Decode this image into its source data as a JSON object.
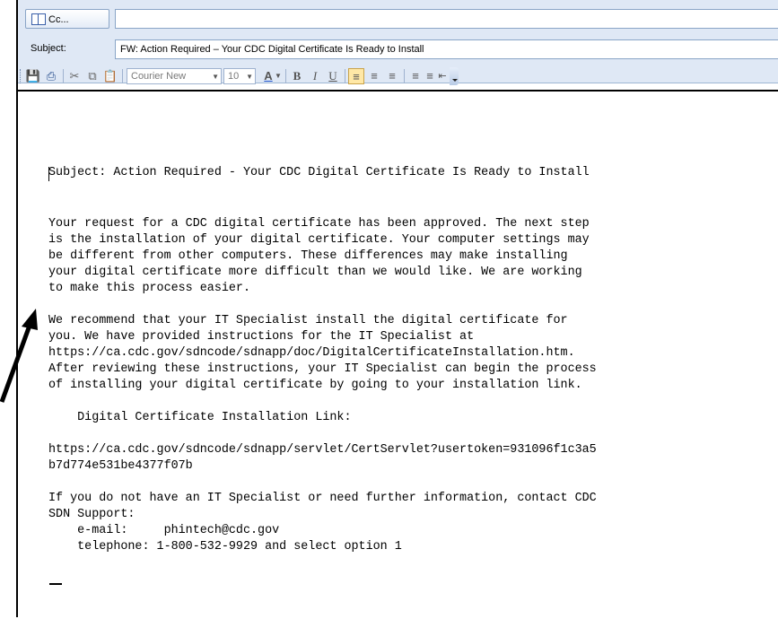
{
  "header": {
    "cc_label": "Cc...",
    "cc_value": "",
    "subject_label": "Subject:",
    "subject_value": "FW: Action Required – Your CDC Digital Certificate Is Ready to Install"
  },
  "toolbar": {
    "font_name": "Courier New",
    "font_size": "10",
    "icons": [
      "save-icon",
      "print-icon",
      "cut-icon",
      "copy-icon",
      "paste-icon",
      "font-color-icon",
      "bold-icon",
      "italic-icon",
      "underline-icon",
      "align-left-icon",
      "align-center-icon",
      "align-right-icon",
      "numbered-list-icon",
      "bulleted-list-icon",
      "decrease-indent-icon",
      "increase-indent-icon"
    ]
  },
  "message": {
    "lines": [
      "Subject: Action Required - Your CDC Digital Certificate Is Ready to Install",
      "Your request for a CDC digital certificate has been approved. The next step",
      "is the installation of your digital certificate. Your computer settings may",
      "be different from other computers. These differences may make installing",
      "your digital certificate more difficult than we would like. We are working",
      "to make this process easier.",
      "We recommend that your IT Specialist install the digital certificate for",
      "you. We have provided instructions for the IT Specialist at",
      "https://ca.cdc.gov/sdncode/sdnapp/doc/DigitalCertificateInstallation.htm.",
      "After reviewing these instructions, your IT Specialist can begin the process",
      "of installing your digital certificate by going to your installation link.",
      "    Digital Certificate Installation Link:",
      "https://ca.cdc.gov/sdncode/sdnapp/servlet/CertServlet?usertoken=931096f1c3a5",
      "b7d774e531be4377f07b",
      "If you do not have an IT Specialist or need further information, contact CDC",
      "SDN Support:",
      "    e-mail:     phintech@cdc.gov",
      "    telephone: 1-800-532-9929 and select option 1"
    ]
  }
}
